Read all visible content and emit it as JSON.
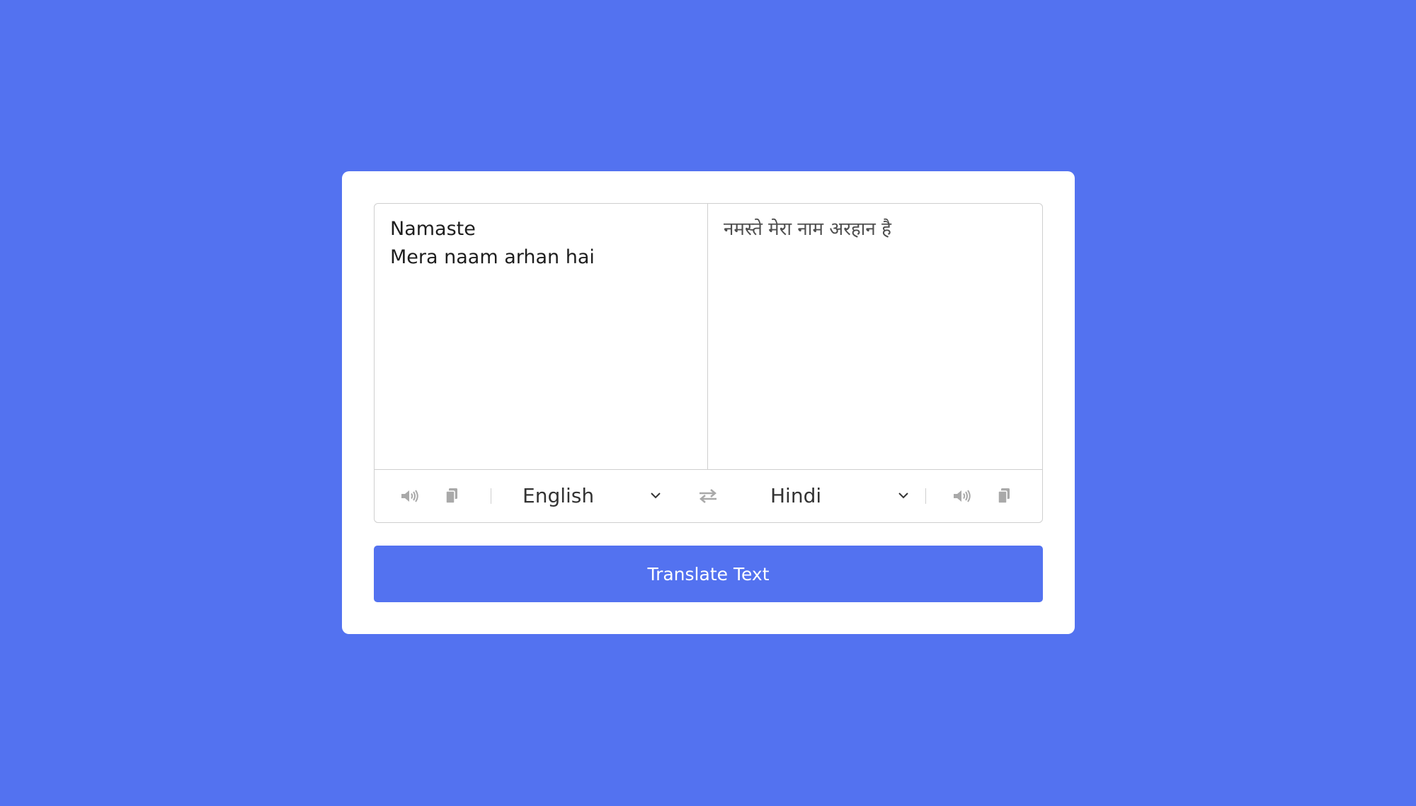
{
  "translator": {
    "from_text": "Namaste\nMera naam arhan hai",
    "to_text": "नमस्ते मेरा नाम अरहान है",
    "from_language": "English",
    "to_language": "Hindi",
    "translate_button_label": "Translate Text"
  },
  "icons": {
    "from_speak": "volume-icon",
    "from_copy": "copy-icon",
    "exchange": "exchange-icon",
    "to_speak": "volume-icon",
    "to_copy": "copy-icon",
    "select_chevron": "chevron-down-icon"
  },
  "colors": {
    "background": "#5372F0",
    "card": "#ffffff",
    "button": "#5372F0",
    "icon": "#a9a9a9",
    "border": "#cfcfcf"
  }
}
